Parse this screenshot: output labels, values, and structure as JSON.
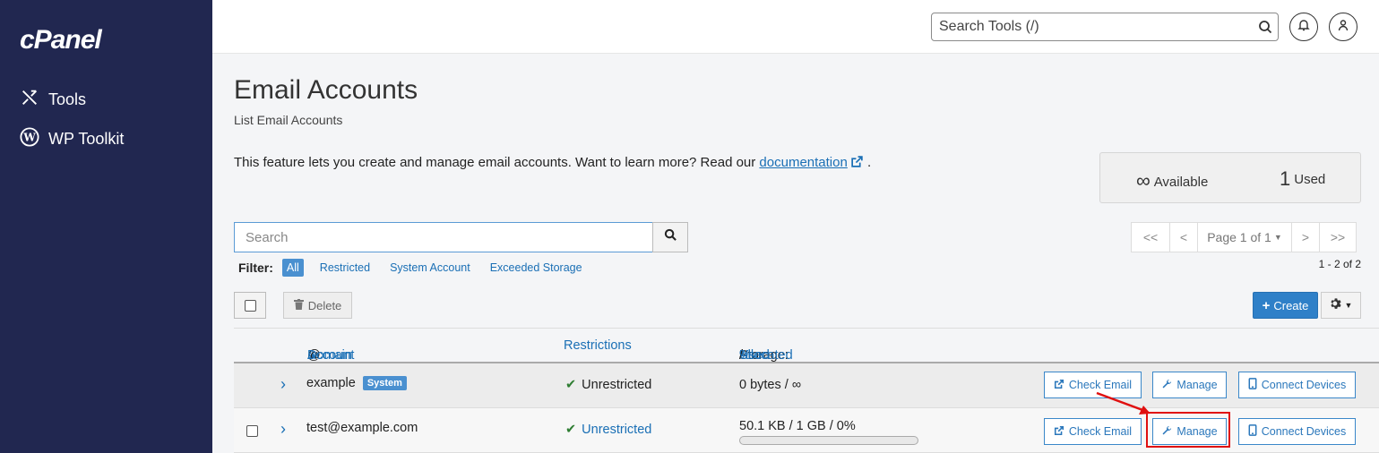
{
  "app": {
    "logo": "cPanel"
  },
  "sidebar": {
    "items": [
      {
        "label": "Tools",
        "icon": "tools-icon"
      },
      {
        "label": "WP Toolkit",
        "icon": "wordpress-icon"
      }
    ]
  },
  "header": {
    "search_placeholder": "Search Tools (/)"
  },
  "page": {
    "title": "Email Accounts",
    "subtitle": "List Email Accounts",
    "intro_text": "This feature lets you create and manage email accounts. Want to learn more? Read our ",
    "intro_link": "documentation",
    "intro_end": "."
  },
  "stats": {
    "available_value": "∞",
    "available_label": "Available",
    "used_value": "1",
    "used_label": "Used"
  },
  "search": {
    "placeholder": "Search"
  },
  "filter": {
    "label": "Filter:",
    "options": [
      "All",
      "Restricted",
      "System Account",
      "Exceeded Storage"
    ],
    "active": "All"
  },
  "pager": {
    "first": "<<",
    "prev": "<",
    "page": "Page 1 of 1",
    "next": ">",
    "last": ">>",
    "range": "1 - 2 of 2"
  },
  "toolbar": {
    "delete": "Delete",
    "create": "Create"
  },
  "table": {
    "headers": {
      "account": "Account",
      "at": "@",
      "domain": "Domain",
      "restrictions": "Restrictions",
      "storage": "Storage:",
      "used": "Used",
      "sep1": "/",
      "allocated": "Allocated",
      "sep2": "/",
      "pct": "%"
    },
    "rows": [
      {
        "account": "example",
        "badge": "System",
        "restriction": "Unrestricted",
        "storage": "0 bytes / ∞",
        "actions": [
          "Check Email",
          "Manage",
          "Connect Devices"
        ]
      },
      {
        "account": "test@example.com",
        "restriction": "Unrestricted",
        "storage": "50.1 KB / 1 GB / 0%",
        "usage_fraction": 0,
        "actions": [
          "Check Email",
          "Manage",
          "Connect Devices"
        ]
      }
    ]
  },
  "colors": {
    "sidebar": "#212750",
    "link": "#1a6fb5",
    "primary": "#2f80c8",
    "highlight": "#e01010"
  }
}
